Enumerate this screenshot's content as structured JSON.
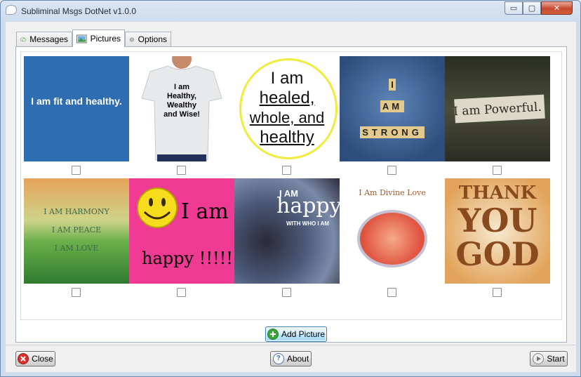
{
  "window": {
    "title": "Subliminal Msgs DotNet v1.0.0",
    "min_symbol": "▭",
    "max_symbol": "▢",
    "close_symbol": "✕"
  },
  "tabs": [
    {
      "label": "Messages",
      "icon": "messages-icon",
      "active": false
    },
    {
      "label": "Pictures",
      "icon": "picture-icon",
      "active": true
    },
    {
      "label": "Options",
      "icon": "gear-icon",
      "active": false
    }
  ],
  "pictures": [
    {
      "text": "I am fit and healthy.",
      "checked": false
    },
    {
      "text": "I am Healthy, Wealthy and Wise!",
      "checked": false
    },
    {
      "text": "I am healed, whole, and healthy",
      "checked": false
    },
    {
      "text": "I AM STRONG",
      "checked": false
    },
    {
      "text": "I am Powerful.",
      "checked": false
    },
    {
      "text": "I AM HARMONY I AM PEACE I AM LOVE",
      "checked": false
    },
    {
      "text": "I am happy !!!!!",
      "checked": false
    },
    {
      "text": "I AM happy WITH WHO I AM",
      "checked": false
    },
    {
      "text": "I Am Divine Love",
      "checked": false
    },
    {
      "text": "THANK YOU GOD",
      "checked": false
    }
  ],
  "pic_text": {
    "p1": "I am fit and healthy.",
    "p2_l1": "I am",
    "p2_l2": "Healthy,",
    "p2_l3": "Wealthy",
    "p2_l4": "and Wise!",
    "p3_l1": "I am",
    "p3_l2": "healed,",
    "p3_l3": "whole, and",
    "p3_l4": "healthy",
    "p4_l1": "I",
    "p4_l2": "AM",
    "p4_l3": "STRONG",
    "p5": "I am Powerful.",
    "p6_l1": "I AM HARMONY",
    "p6_l2": "I AM PEACE",
    "p6_l3": "I AM LOVE",
    "p7_l1": "I am",
    "p7_l2": "happy !!!!!",
    "p8_l1": "I AM",
    "p8_l2": "happy",
    "p8_l3": "WITH WHO I AM",
    "p9": "I Am Divine Love",
    "p10_l1": "THANK",
    "p10_l2": "YOU",
    "p10_l3": "GOD"
  },
  "buttons": {
    "add_picture": "Add Picture",
    "close": "Close",
    "about": "About",
    "start": "Start"
  },
  "colors": {
    "accent": "#3c7fb1",
    "add_icon": "#3ea33a",
    "close_icon": "#d9312b",
    "about_icon": "#4a6fa5"
  }
}
